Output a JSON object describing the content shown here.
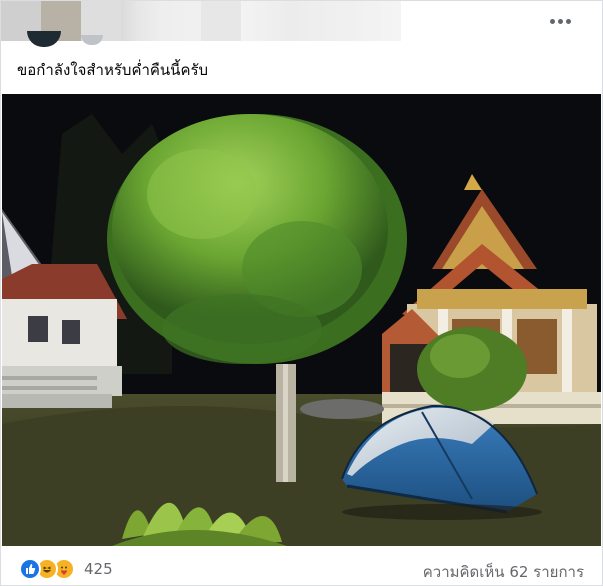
{
  "post": {
    "caption": "ขอกำลังใจสำหรับค่ำคืนนี้ครับ",
    "more_icon": "more-horizontal-icon",
    "photo_icon": "photo-tent-temple-night"
  },
  "footer": {
    "reactions": [
      "like-icon",
      "haha-icon",
      "care-icon"
    ],
    "reaction_count": "425",
    "comments_label": "ความคิดเห็น 62 รายการ"
  },
  "colors": {
    "like": "#1b74e4",
    "emoji": "#f7b125",
    "muted_text": "#65676b",
    "tent_blue": "#2f6fa8",
    "tree_green": "#6aa532"
  }
}
